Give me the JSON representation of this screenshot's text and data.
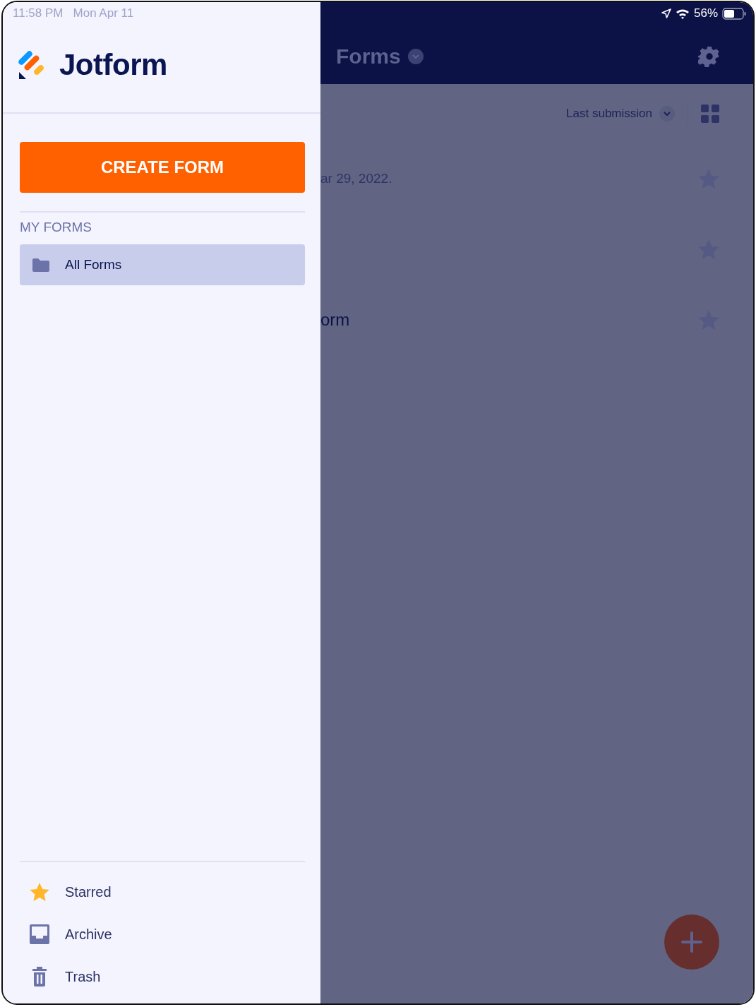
{
  "status_bar": {
    "time": "11:58 PM",
    "date": "Mon Apr 11",
    "battery": "56%"
  },
  "drawer": {
    "logo": "Jotform",
    "create_button": "CREATE FORM",
    "section_label": "MY FORMS",
    "folders": [
      {
        "label": "All Forms",
        "selected": true
      }
    ],
    "bottom_items": [
      {
        "kind": "starred",
        "label": "Starred"
      },
      {
        "kind": "archive",
        "label": "Archive"
      },
      {
        "kind": "trash",
        "label": "Trash"
      }
    ]
  },
  "header": {
    "title": "Forms"
  },
  "toolbar": {
    "sort": "Last submission"
  },
  "forms": [
    {
      "subtitle": "ar 29, 2022.",
      "starred": false
    },
    {
      "starred": false
    },
    {
      "title": "orm",
      "starred": false
    }
  ]
}
